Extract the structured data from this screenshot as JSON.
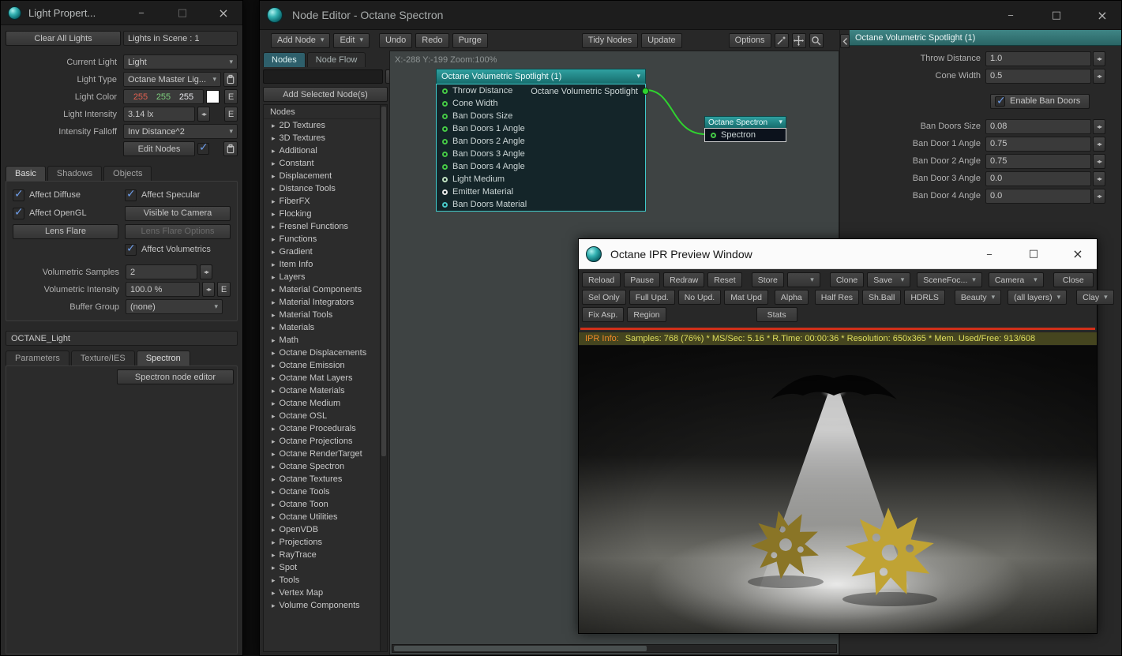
{
  "misc": {
    "e": "E"
  },
  "light_window": {
    "title": "Light Propert...",
    "clear_all": "Clear All Lights",
    "lights_in_scene": "Lights in Scene : 1",
    "current_light": {
      "label": "Current Light",
      "value": "Light"
    },
    "light_type": {
      "label": "Light Type",
      "value": "Octane Master Lig..."
    },
    "light_color": {
      "label": "Light Color",
      "r": "255",
      "g": "255",
      "b": "255"
    },
    "light_intensity": {
      "label": "Light Intensity",
      "value": "3.14 lx"
    },
    "intensity_falloff": {
      "label": "Intensity Falloff",
      "value": "Inv Distance^2"
    },
    "edit_nodes": "Edit Nodes",
    "tabs": [
      "Basic",
      "Shadows",
      "Objects"
    ],
    "affect_diffuse": "Affect Diffuse",
    "affect_specular": "Affect Specular",
    "affect_opengl": "Affect OpenGL",
    "visible_to_camera": "Visible to Camera",
    "lens_flare": "Lens Flare",
    "lens_flare_options": "Lens Flare Options",
    "affect_volumetrics": "Affect Volumetrics",
    "volumetric_samples": {
      "label": "Volumetric Samples",
      "value": "2"
    },
    "volumetric_intensity": {
      "label": "Volumetric Intensity",
      "value": "100.0 %"
    },
    "buffer_group": {
      "label": "Buffer Group",
      "value": "(none)"
    },
    "octane_light": "OCTANE_Light",
    "sub_tabs": [
      "Parameters",
      "Texture/IES",
      "Spectron"
    ],
    "spectron_editor_button": "Spectron node editor"
  },
  "node_editor": {
    "title": "Node Editor - Octane Spectron",
    "toolbar": {
      "add_node": "Add Node",
      "edit": "Edit",
      "undo": "Undo",
      "redo": "Redo",
      "purge": "Purge",
      "tidy_nodes": "Tidy Nodes",
      "update": "Update",
      "options": "Options"
    },
    "tabs": [
      "Nodes",
      "Node Flow"
    ],
    "add_selected": "Add Selected Node(s)",
    "list_header": "Nodes",
    "categories": [
      "2D Textures",
      "3D Textures",
      "Additional",
      "Constant",
      "Displacement",
      "Distance Tools",
      "FiberFX",
      "Flocking",
      "Fresnel Functions",
      "Functions",
      "Gradient",
      "Item Info",
      "Layers",
      "Material Components",
      "Material Integrators",
      "Material Tools",
      "Materials",
      "Math",
      "Octane Displacements",
      "Octane Emission",
      "Octane Mat Layers",
      "Octane Materials",
      "Octane Medium",
      "Octane OSL",
      "Octane Procedurals",
      "Octane Projections",
      "Octane RenderTarget",
      "Octane Spectron",
      "Octane Textures",
      "Octane Tools",
      "Octane Toon",
      "Octane Utilities",
      "OpenVDB",
      "Projections",
      "RayTrace",
      "Spot",
      "Tools",
      "Vertex Map",
      "Volume Components"
    ],
    "canvas": {
      "status": "X:-288 Y:-199 Zoom:100%",
      "node1": {
        "title": "Octane Volumetric Spotlight (1)",
        "inputs": [
          {
            "label": "Throw Distance",
            "color": "#46c846"
          },
          {
            "label": "Cone Width",
            "color": "#46c846"
          },
          {
            "label": "Ban Doors Size",
            "color": "#46c846"
          },
          {
            "label": "Ban Doors 1 Angle",
            "color": "#46c846"
          },
          {
            "label": "Ban Doors 2 Angle",
            "color": "#46c846"
          },
          {
            "label": "Ban Doors 3 Angle",
            "color": "#46c846"
          },
          {
            "label": "Ban Doors 4 Angle",
            "color": "#46c846"
          },
          {
            "label": "Light Medium",
            "color": "#bfe0c0"
          },
          {
            "label": "Emitter Material",
            "color": "#e8e8e8"
          },
          {
            "label": "Ban Doors Material",
            "color": "#49c8c8"
          }
        ],
        "output_label": "Octane Volumetric Spotlight"
      },
      "node2": {
        "title": "Octane Spectron",
        "input": "Spectron"
      }
    },
    "props": {
      "header": "Octane Volumetric Spotlight (1)",
      "fields": [
        {
          "label": "Throw Distance",
          "value": "1.0"
        },
        {
          "label": "Cone Width",
          "value": "0.5"
        }
      ],
      "enable_ban_doors": "Enable Ban Doors",
      "ban_fields": [
        {
          "label": "Ban Doors Size",
          "value": "0.08"
        },
        {
          "label": "Ban Door 1 Angle",
          "value": "0.75"
        },
        {
          "label": "Ban Door 2 Angle",
          "value": "0.75"
        },
        {
          "label": "Ban Door 3 Angle",
          "value": "0.0"
        },
        {
          "label": "Ban Door 4 Angle",
          "value": "0.0"
        }
      ]
    }
  },
  "ipr": {
    "title": "Octane IPR Preview Window",
    "r1": {
      "reload": "Reload",
      "pause": "Pause",
      "redraw": "Redraw",
      "reset": "Reset",
      "store": "Store",
      "clone": "Clone",
      "save": "Save",
      "scenefoc": "SceneFoc...",
      "camera": "Camera",
      "close": "Close"
    },
    "r2": {
      "sel_only": "Sel Only",
      "full_upd": "Full Upd.",
      "no_upd": "No Upd.",
      "mat_upd": "Mat Upd",
      "alpha": "Alpha",
      "half_res": "Half Res",
      "sh_ball": "Sh.Ball",
      "hdrls": "HDRLS",
      "beauty": "Beauty",
      "all_layers": "(all layers)",
      "clay": "Clay"
    },
    "r3": {
      "fix_asp": "Fix Asp.",
      "region": "Region",
      "stats": "Stats"
    },
    "info": {
      "label": "IPR Info:",
      "text": "Samples: 768 (76%)  *  MS/Sec: 5.16  *  R.Time: 00:00:36  *  Resolution: 650x365  *  Mem. Used/Free: 913/608"
    }
  }
}
